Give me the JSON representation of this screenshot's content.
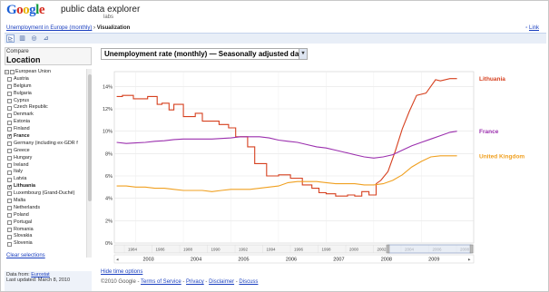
{
  "header": {
    "logo_letters": [
      {
        "ch": "G",
        "color": "#1a5fd6"
      },
      {
        "ch": "o",
        "color": "#d62b1f"
      },
      {
        "ch": "o",
        "color": "#e8b100"
      },
      {
        "ch": "g",
        "color": "#1a5fd6"
      },
      {
        "ch": "l",
        "color": "#109a3a"
      },
      {
        "ch": "e",
        "color": "#d62b1f"
      }
    ],
    "app_name": "public data explorer",
    "labs": "labs",
    "breadcrumb_link": "Unemployment in Europe (monthly)",
    "breadcrumb_sep": " › ",
    "breadcrumb_current": "Visualization",
    "link_label": "Link"
  },
  "toolbar": {
    "icons": [
      "line-chart-icon",
      "bar-chart-icon",
      "bubble-chart-icon",
      "map-icon"
    ],
    "selected": 0
  },
  "left": {
    "compare_label": "Compare",
    "location_label": "Location",
    "items": [
      {
        "label": "European Union",
        "checked": false,
        "root": true
      },
      {
        "label": "Austria",
        "checked": false
      },
      {
        "label": "Belgium",
        "checked": false
      },
      {
        "label": "Bulgaria",
        "checked": false
      },
      {
        "label": "Cyprus",
        "checked": false
      },
      {
        "label": "Czech Republic",
        "checked": false
      },
      {
        "label": "Denmark",
        "checked": false
      },
      {
        "label": "Estonia",
        "checked": false
      },
      {
        "label": "Finland",
        "checked": false
      },
      {
        "label": "France",
        "checked": true
      },
      {
        "label": "Germany (including ex-GDR f",
        "checked": false
      },
      {
        "label": "Greece",
        "checked": false
      },
      {
        "label": "Hungary",
        "checked": false
      },
      {
        "label": "Ireland",
        "checked": false
      },
      {
        "label": "Italy",
        "checked": false
      },
      {
        "label": "Latvia",
        "checked": false
      },
      {
        "label": "Lithuania",
        "checked": true
      },
      {
        "label": "Luxembourg (Grand-Duché)",
        "checked": false
      },
      {
        "label": "Malta",
        "checked": false
      },
      {
        "label": "Netherlands",
        "checked": false
      },
      {
        "label": "Poland",
        "checked": false
      },
      {
        "label": "Portugal",
        "checked": false
      },
      {
        "label": "Romania",
        "checked": false
      },
      {
        "label": "Slovakia",
        "checked": false
      },
      {
        "label": "Slovenia",
        "checked": false
      }
    ],
    "clear_label": "Clear selections",
    "data_from_prefix": "Data from: ",
    "data_from_link": "Eurostat",
    "last_updated": "Last updated: March 8, 2010"
  },
  "main": {
    "metric_selected": "Unemployment rate (monthly) — Seasonally adjusted data",
    "hide_time_options": "Hide time options",
    "footer_prefix": "©2010 Google - ",
    "footer_links": [
      "Terms of Service",
      "Privacy",
      "Disclaimer",
      "Discuss"
    ]
  },
  "chart_data": {
    "type": "line",
    "title": "Unemployment rate (monthly) — Seasonally adjusted data",
    "xlabel": "",
    "ylabel": "",
    "xlim": [
      2002.55,
      2010.1
    ],
    "ylim": [
      0,
      15
    ],
    "y_ticks": [
      0,
      2,
      4,
      6,
      8,
      10,
      12,
      14
    ],
    "y_tick_labels": [
      "0%",
      "2%",
      "4%",
      "6%",
      "8%",
      "10%",
      "12%",
      "14%"
    ],
    "x_ticks": [
      2003,
      2004,
      2005,
      2006,
      2007,
      2008,
      2009
    ],
    "x_tick_labels": [
      "2003",
      "2004",
      "2005",
      "2006",
      "2007",
      "2008",
      "2009"
    ],
    "grid": true,
    "legend_placement": "right, at line ends",
    "series": [
      {
        "name": "Lithuania",
        "color": "#d6401f",
        "x": [
          2002.6,
          2002.72,
          2002.72,
          2002.95,
          2002.95,
          2003.25,
          2003.25,
          2003.45,
          2003.45,
          2003.55,
          2003.55,
          2003.7,
          2003.7,
          2003.8,
          2003.8,
          2004.0,
          2004.0,
          2004.25,
          2004.25,
          2004.4,
          2004.4,
          2004.75,
          2004.75,
          2004.95,
          2004.95,
          2005.1,
          2005.1,
          2005.35,
          2005.35,
          2005.5,
          2005.5,
          2005.75,
          2005.75,
          2006.0,
          2006.0,
          2006.25,
          2006.25,
          2006.5,
          2006.5,
          2006.7,
          2006.7,
          2006.85,
          2006.85,
          2007.0,
          2007.0,
          2007.2,
          2007.2,
          2007.45,
          2007.45,
          2007.6,
          2007.6,
          2007.75,
          2007.75,
          2007.9,
          2007.9,
          2008.05,
          2008.05,
          2008.15,
          2008.3,
          2008.45,
          2008.6,
          2008.75,
          2008.9,
          2009.1,
          2009.3,
          2009.4,
          2009.6,
          2009.75
        ],
        "y": [
          13.1,
          13.1,
          13.2,
          13.2,
          12.9,
          12.9,
          13.1,
          13.1,
          12.4,
          12.4,
          12.5,
          12.5,
          11.9,
          11.9,
          12.4,
          12.4,
          11.3,
          11.3,
          11.6,
          11.6,
          10.9,
          10.9,
          10.6,
          10.6,
          10.3,
          10.3,
          9.5,
          9.5,
          8.6,
          8.6,
          7.1,
          7.1,
          6.0,
          6.0,
          6.1,
          6.1,
          5.8,
          5.8,
          5.2,
          5.2,
          4.9,
          4.9,
          4.5,
          4.5,
          4.4,
          4.4,
          4.2,
          4.2,
          4.3,
          4.3,
          4.2,
          4.2,
          4.6,
          4.6,
          4.3,
          4.3,
          5.3,
          5.6,
          6.4,
          8.2,
          10.2,
          11.8,
          13.2,
          13.4,
          14.6,
          14.5,
          14.7,
          14.7
        ]
      },
      {
        "name": "France",
        "color": "#9b2fae",
        "x": [
          2002.6,
          2002.8,
          2003.0,
          2003.2,
          2003.4,
          2003.6,
          2003.8,
          2004.0,
          2004.2,
          2004.4,
          2004.6,
          2004.8,
          2005.0,
          2005.2,
          2005.4,
          2005.6,
          2005.8,
          2006.0,
          2006.2,
          2006.4,
          2006.6,
          2006.8,
          2007.0,
          2007.2,
          2007.4,
          2007.6,
          2007.8,
          2008.0,
          2008.2,
          2008.4,
          2008.6,
          2008.8,
          2009.0,
          2009.2,
          2009.4,
          2009.6,
          2009.75
        ],
        "y": [
          9.0,
          8.9,
          8.95,
          9.0,
          9.1,
          9.15,
          9.25,
          9.3,
          9.3,
          9.3,
          9.3,
          9.35,
          9.4,
          9.5,
          9.5,
          9.5,
          9.4,
          9.2,
          9.1,
          9.0,
          8.8,
          8.6,
          8.5,
          8.3,
          8.1,
          7.9,
          7.7,
          7.6,
          7.7,
          7.9,
          8.3,
          8.7,
          9.0,
          9.3,
          9.6,
          9.9,
          10.0
        ]
      },
      {
        "name": "United Kingdom",
        "color": "#f0a020",
        "x": [
          2002.6,
          2002.8,
          2003.0,
          2003.2,
          2003.4,
          2003.6,
          2003.8,
          2004.0,
          2004.2,
          2004.4,
          2004.6,
          2004.8,
          2005.0,
          2005.2,
          2005.4,
          2005.6,
          2005.8,
          2006.0,
          2006.2,
          2006.4,
          2006.6,
          2006.8,
          2007.0,
          2007.2,
          2007.4,
          2007.6,
          2007.8,
          2008.0,
          2008.2,
          2008.4,
          2008.6,
          2008.8,
          2009.0,
          2009.2,
          2009.4,
          2009.6,
          2009.75
        ],
        "y": [
          5.1,
          5.1,
          5.0,
          5.0,
          4.9,
          4.9,
          4.8,
          4.7,
          4.7,
          4.7,
          4.6,
          4.7,
          4.8,
          4.8,
          4.8,
          4.9,
          5.0,
          5.1,
          5.4,
          5.5,
          5.5,
          5.5,
          5.4,
          5.3,
          5.3,
          5.3,
          5.2,
          5.2,
          5.3,
          5.6,
          6.1,
          6.8,
          7.3,
          7.7,
          7.8,
          7.8,
          7.8
        ]
      }
    ],
    "timeline_ticks": [
      "1984",
      "1986",
      "1988",
      "1990",
      "1992",
      "1994",
      "1996",
      "1998",
      "2000",
      "2002",
      "2004",
      "2006",
      "2008"
    ]
  }
}
